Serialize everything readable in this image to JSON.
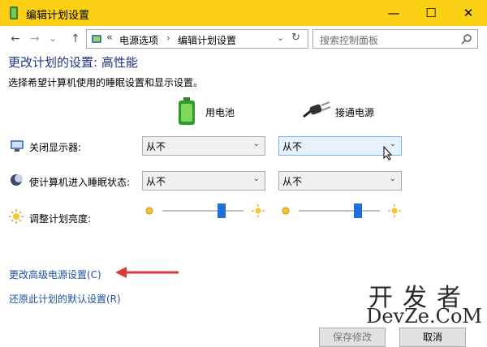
{
  "window": {
    "title": "编辑计划设置",
    "minimize_glyph": "—",
    "maximize_glyph": "☐",
    "close_glyph": "✕"
  },
  "nav": {
    "back_glyph": "←",
    "forward_glyph": "→",
    "recent_glyph": "⌄",
    "up_glyph": "↑",
    "breadcrumb_sep": "«",
    "breadcrumb": [
      "电源选项",
      "编辑计划设置"
    ],
    "breadcrumb_arrow": "›",
    "dropdown_glyph": "⌄",
    "refresh_glyph": "↻",
    "search_placeholder": "搜索控制面板",
    "search_icon": "search-icon"
  },
  "main": {
    "heading": "更改计划的设置: 高性能",
    "subtext": "选择希望计算机使用的睡眠设置和显示设置。",
    "col_battery": "用电池",
    "col_plugged": "接通电源",
    "rows": [
      {
        "label": "关闭显示器:",
        "battery_value": "从不",
        "plugged_value": "从不"
      },
      {
        "label": "使计算机进入睡眠状态:",
        "battery_value": "从不",
        "plugged_value": "从不"
      }
    ],
    "brightness_label": "调整计划亮度:",
    "brightness_battery_level": 0.73,
    "brightness_plugged_level": 0.73,
    "link_advanced": "更改高级电源设置(C)",
    "link_restore": "还原此计划的默认设置(R)",
    "save_button": "保存修改",
    "cancel_button": "取消"
  },
  "watermark": {
    "cn": "开发者",
    "en": "DevZe.CoM"
  },
  "colors": {
    "titlebar": "#fbd015",
    "heading": "#1e3287",
    "link": "#1e50a2",
    "arrow": "#d83a3a",
    "slider_thumb": "#1e6dd8"
  }
}
